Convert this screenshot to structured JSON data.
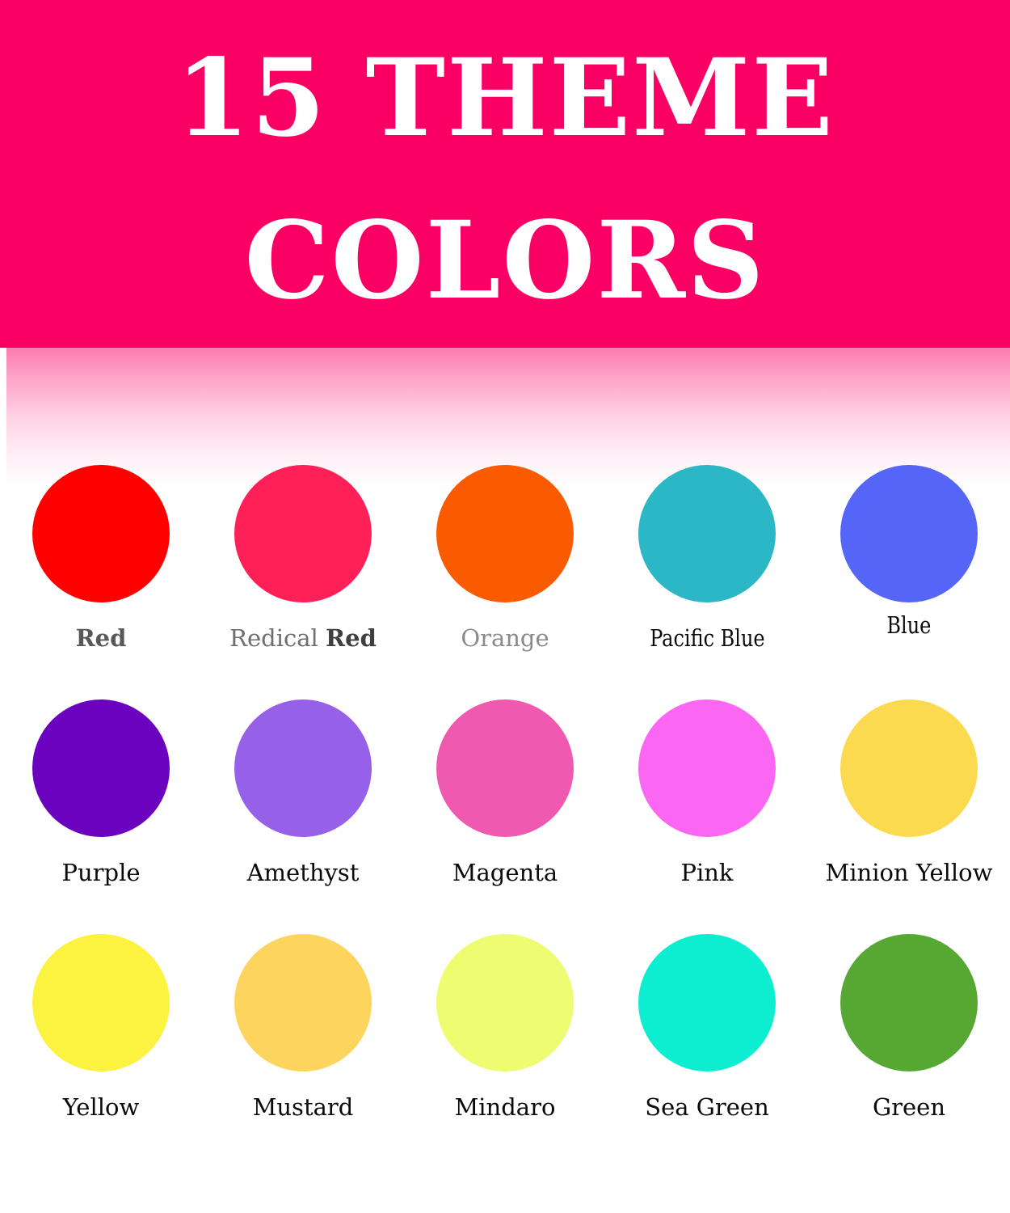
{
  "header": {
    "title": "15 THEME\nCOLORS",
    "background_color": "#FB0064",
    "text_color": "#FFFFFF"
  },
  "gradient": {
    "from_color": "#FB7CAD",
    "to_color": "#FFFFFF"
  },
  "palette": {
    "count_label": "15",
    "rows": [
      {
        "swatches": [
          {
            "label": "Red",
            "color": "#FF0000"
          },
          {
            "label": "Redical Red",
            "color": "#FF2057",
            "label_regular": "Redical ",
            "label_bold": "Red"
          },
          {
            "label": "Orange",
            "color": "#FB5B00"
          },
          {
            "label": "Pacific Blue",
            "color": "#2BB7C6"
          },
          {
            "label": "Blue",
            "color": "#5465F7"
          }
        ]
      },
      {
        "swatches": [
          {
            "label": "Purple",
            "color": "#6B02BF"
          },
          {
            "label": "Amethyst",
            "color": "#9660E8"
          },
          {
            "label": "Magenta",
            "color": "#F059B0"
          },
          {
            "label": "Pink",
            "color": "#FB66F2"
          },
          {
            "label": "Minion Yellow",
            "color": "#FBDA4F"
          }
        ]
      },
      {
        "swatches": [
          {
            "label": "Yellow",
            "color": "#FBF33F"
          },
          {
            "label": "Mustard",
            "color": "#FDD45E"
          },
          {
            "label": "Mindaro",
            "color": "#EEFC72"
          },
          {
            "label": "Sea Green",
            "color": "#0DEDCF"
          },
          {
            "label": "Green",
            "color": "#56A832"
          }
        ]
      }
    ]
  }
}
